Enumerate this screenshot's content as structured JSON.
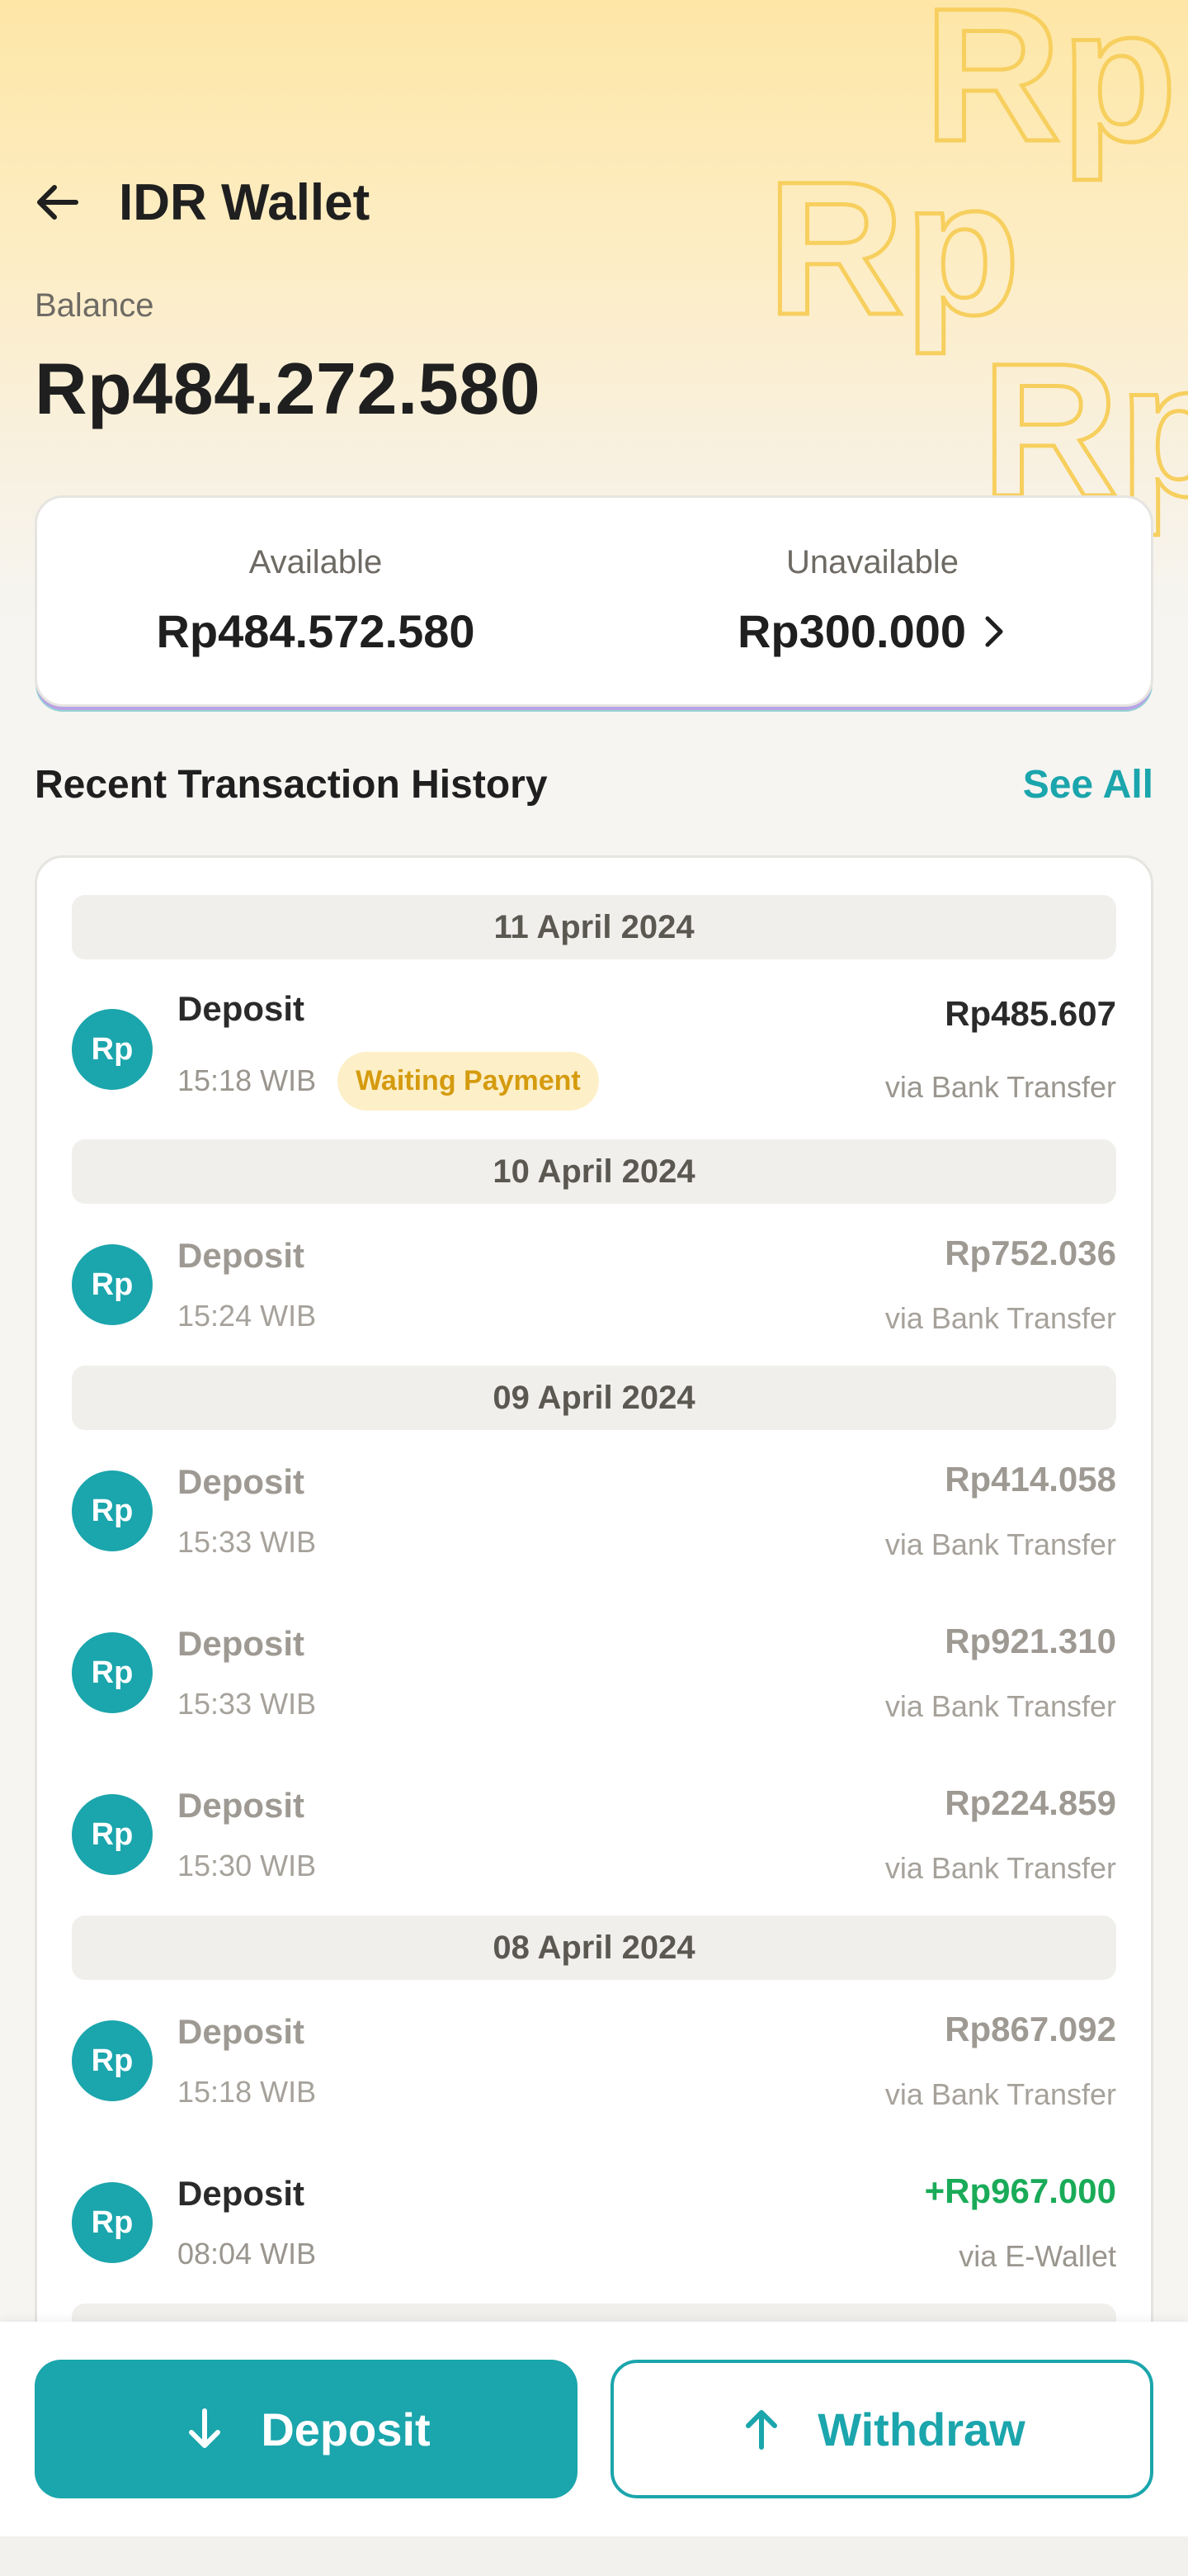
{
  "header": {
    "title": "IDR Wallet",
    "balance_label": "Balance",
    "balance_value": "Rp484.272.580",
    "watermark_text": "Rp"
  },
  "summary": {
    "available_label": "Available",
    "available_value": "Rp484.572.580",
    "unavailable_label": "Unavailable",
    "unavailable_value": "Rp300.000"
  },
  "history": {
    "title": "Recent Transaction History",
    "see_all": "See All",
    "groups": [
      {
        "date": "11 April 2024",
        "items": [
          {
            "avatar": "Rp",
            "name": "Deposit",
            "time": "15:18 WIB",
            "badge": "Waiting Payment",
            "amount": "Rp485.607",
            "method": "via Bank Transfer"
          }
        ]
      },
      {
        "date": "10 April 2024",
        "items": [
          {
            "avatar": "Rp",
            "name": "Deposit",
            "time": "15:24 WIB",
            "amount": "Rp752.036",
            "method": "via Bank Transfer"
          }
        ]
      },
      {
        "date": "09 April 2024",
        "items": [
          {
            "avatar": "Rp",
            "name": "Deposit",
            "time": "15:33 WIB",
            "amount": "Rp414.058",
            "method": "via Bank Transfer"
          },
          {
            "avatar": "Rp",
            "name": "Deposit",
            "time": "15:33 WIB",
            "amount": "Rp921.310",
            "method": "via Bank Transfer"
          },
          {
            "avatar": "Rp",
            "name": "Deposit",
            "time": "15:30 WIB",
            "amount": "Rp224.859",
            "method": "via Bank Transfer"
          }
        ]
      },
      {
        "date": "08 April 2024",
        "items": [
          {
            "avatar": "Rp",
            "name": "Deposit",
            "time": "15:18 WIB",
            "amount": "Rp867.092",
            "method": "via Bank Transfer"
          },
          {
            "avatar": "Rp",
            "name": "Deposit",
            "time": "08:04 WIB",
            "amount": "+Rp967.000",
            "method": "via E-Wallet"
          }
        ]
      }
    ]
  },
  "actions": {
    "deposit_label": "Deposit",
    "withdraw_label": "Withdraw"
  },
  "colors": {
    "accent": "#1ba5ac",
    "pending": "#d59b0f",
    "success": "#1aab58"
  },
  "icons": {
    "back": "arrow-left-icon",
    "chevron": "chevron-right-icon",
    "deposit": "arrow-down-icon",
    "withdraw": "arrow-up-icon"
  }
}
